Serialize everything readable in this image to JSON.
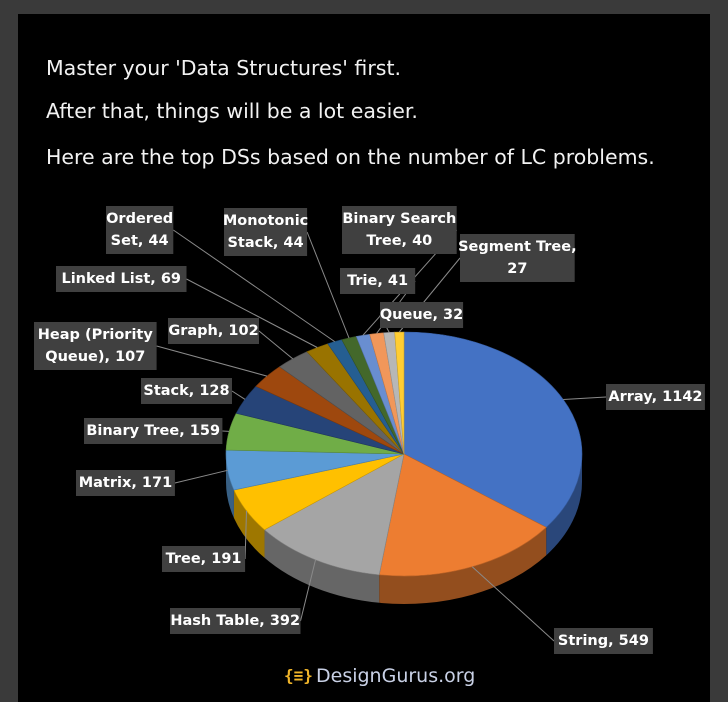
{
  "header": {
    "line1": "Master your 'Data Structures' first.",
    "line2": "After that, things will be a lot easier.",
    "line3": "Here are the top DSs based on the number of LC problems."
  },
  "footer": {
    "brand": "DesignGurus.org",
    "logo_icon": "curly-braces-code-icon"
  },
  "chart_data": {
    "type": "pie",
    "title": "",
    "style": "3d",
    "slices": [
      {
        "label": "Array",
        "value": 1142,
        "color": "#4472C4"
      },
      {
        "label": "String",
        "value": 549,
        "color": "#ED7D31"
      },
      {
        "label": "Hash Table",
        "value": 392,
        "color": "#A5A5A5"
      },
      {
        "label": "Tree",
        "value": 191,
        "color": "#FFC000"
      },
      {
        "label": "Matrix",
        "value": 171,
        "color": "#5B9BD5"
      },
      {
        "label": "Binary Tree",
        "value": 159,
        "color": "#70AD47"
      },
      {
        "label": "Stack",
        "value": 128,
        "color": "#264478"
      },
      {
        "label": "Heap (Priority Queue)",
        "value": 107,
        "color": "#9E480E"
      },
      {
        "label": "Graph",
        "value": 102,
        "color": "#636363"
      },
      {
        "label": "Linked List",
        "value": 69,
        "color": "#997300"
      },
      {
        "label": "Ordered Set",
        "value": 44,
        "color": "#255E91"
      },
      {
        "label": "Monotonic Stack",
        "value": 44,
        "color": "#43682B"
      },
      {
        "label": "Binary Search Tree",
        "value": 40,
        "color": "#698ED0"
      },
      {
        "label": "Trie",
        "value": 41,
        "color": "#F1975A"
      },
      {
        "label": "Queue",
        "value": 32,
        "color": "#B7B7B7"
      },
      {
        "label": "Segment Tree",
        "value": 27,
        "color": "#FFCD33"
      }
    ]
  }
}
